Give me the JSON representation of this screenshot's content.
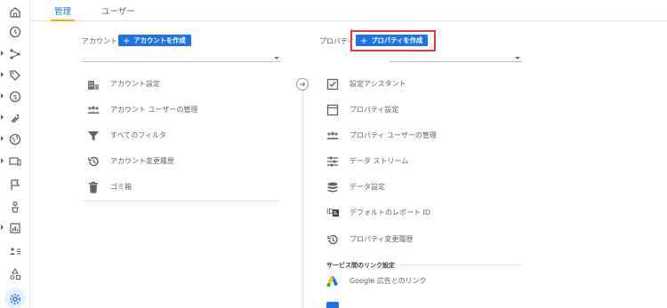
{
  "tabs": [
    {
      "label": "管理"
    },
    {
      "label": "ユーザー"
    }
  ],
  "account": {
    "header_label": "アカウント",
    "create_button": "アカウントを作成",
    "items": [
      {
        "label": "アカウント設定",
        "icon": "building-icon"
      },
      {
        "label": "アカウント ユーザーの管理",
        "icon": "people-icon"
      },
      {
        "label": "すべてのフィルタ",
        "icon": "filter-icon"
      },
      {
        "label": "アカウント変更履歴",
        "icon": "history-icon"
      },
      {
        "label": "ゴミ箱",
        "icon": "trash-icon"
      }
    ]
  },
  "property": {
    "header_label": "プロパティ",
    "create_button": "プロパティを作成",
    "items": [
      {
        "label": "設定アシスタント",
        "icon": "checkbox-icon"
      },
      {
        "label": "プロパティ設定",
        "icon": "window-icon"
      },
      {
        "label": "プロパティ ユーザーの管理",
        "icon": "people-icon"
      },
      {
        "label": "データ ストリーム",
        "icon": "streams-icon"
      },
      {
        "label": "データ設定",
        "icon": "database-icon"
      },
      {
        "label": "デフォルトのレポート ID",
        "icon": "id-icon",
        "prefix": "ID"
      },
      {
        "label": "プロパティ変更履歴",
        "icon": "history-icon"
      }
    ],
    "section_title": "サービス間のリンク設定",
    "links": [
      {
        "label": "Google 広告とのリンク",
        "icon": "google-ads-icon"
      }
    ]
  },
  "colors": {
    "accent": "#1a73e8",
    "tab_indicator": "#f9ab00",
    "highlight": "#e53935"
  }
}
